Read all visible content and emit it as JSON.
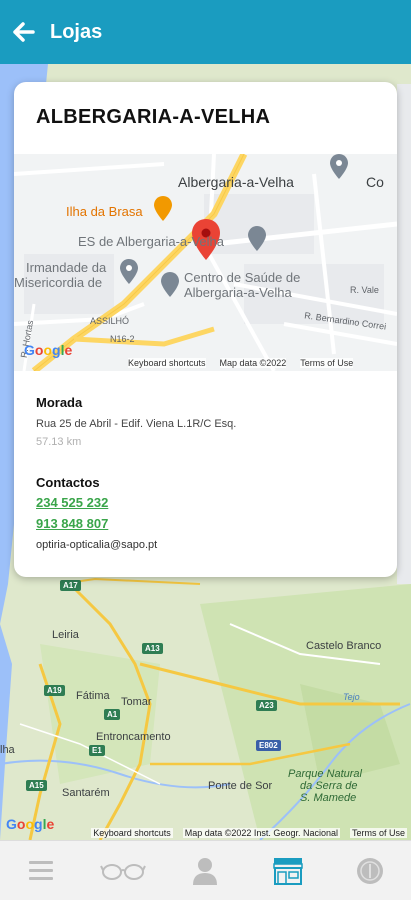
{
  "header": {
    "title": "Lojas",
    "back_icon": "arrow-left-icon"
  },
  "store": {
    "name": "ALBERGARIA-A-VELHA",
    "address_label": "Morada",
    "address": "Rua 25 de Abril - Edif. Viena L.1R/C Esq.",
    "distance": "57.13 km",
    "contacts_label": "Contactos",
    "phone_1": "234 525 232",
    "phone_2": "913 848 807",
    "email": "optiria-opticalia@sapo.pt"
  },
  "card_map": {
    "labels": {
      "town": "Albergaria-a-Velha",
      "ilha": "Ilha da Brasa",
      "es": "ES de Albergaria-a-Velha",
      "irmandade_1": "Irmandade da",
      "irmandade_2": "Misericordia de",
      "centro_1": "Centro de Saúde de",
      "centro_2": "Albergaria-a-Velha",
      "assilho": "ASSILHÓ",
      "r_vale": "R. Vale",
      "r_bernardino": "R. Bernardino Correi",
      "r_hortas": "R. Hortas",
      "n162": "N16-2",
      "co": "Co"
    },
    "google": "Google",
    "shortcuts": "Keyboard shortcuts",
    "map_data": "Map data ©2022",
    "terms": "Terms of Use"
  },
  "bg_map": {
    "labels": {
      "leiria": "Leiria",
      "fatima": "Fátima",
      "tomar": "Tomar",
      "castelo_branco": "Castelo Branco",
      "entroncamento": "Entroncamento",
      "santarem": "Santarém",
      "ponte_de_sor": "Ponte de Sor",
      "parque_1": "Parque Natural",
      "parque_2": "da Serra de",
      "parque_3": "S. Mamede",
      "tejo": "Tejo",
      "lha": "lha"
    },
    "shields": {
      "a17": "A17",
      "a13": "A13",
      "a19": "A19",
      "a1": "A1",
      "a23": "A23",
      "e1": "E1",
      "e802": "E802",
      "a15": "A15"
    },
    "google": "Google",
    "shortcuts": "Keyboard shortcuts",
    "map_data": "Map data ©2022 Inst. Geogr. Nacional",
    "terms": "Terms of Use"
  },
  "bottom_nav": [
    {
      "icon": "menu-icon",
      "active": false
    },
    {
      "icon": "glasses-icon",
      "active": false
    },
    {
      "icon": "user-icon",
      "active": false
    },
    {
      "icon": "store-icon",
      "active": true
    },
    {
      "icon": "coin-icon",
      "active": false
    }
  ],
  "colors": {
    "header": "#1a9cc0",
    "active": "#1a9cc0",
    "inactive": "#bdbdbd",
    "phone": "#3aa54a",
    "pin": "#ea4335"
  }
}
